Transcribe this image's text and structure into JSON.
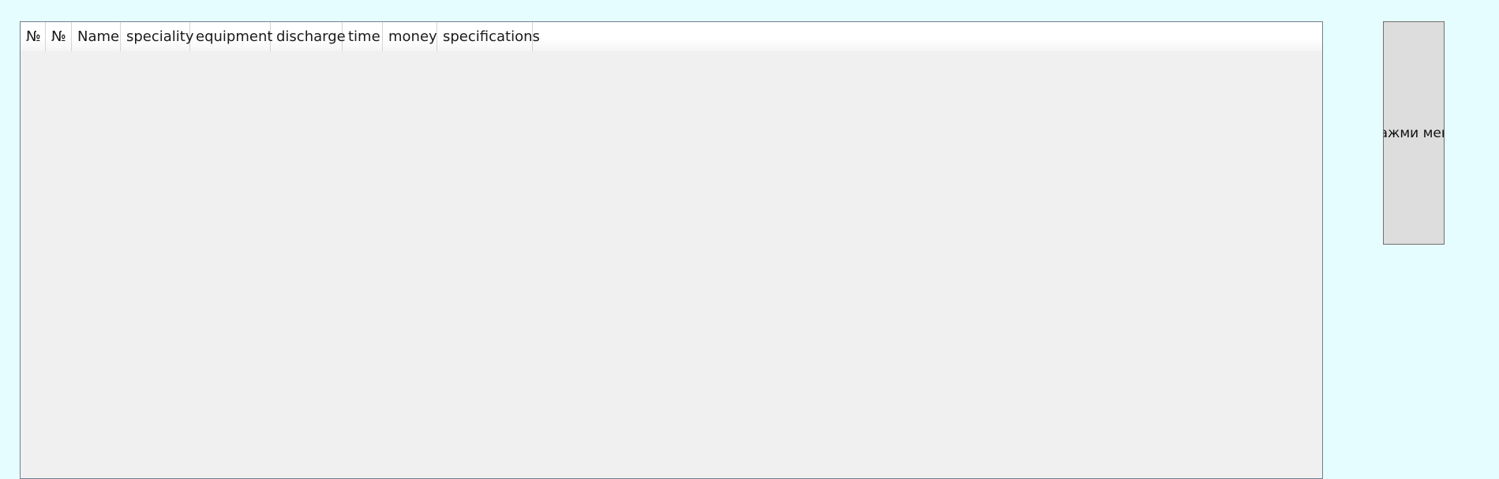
{
  "grid": {
    "columns": [
      {
        "label": "№"
      },
      {
        "label": "№"
      },
      {
        "label": "Name"
      },
      {
        "label": "speciality"
      },
      {
        "label": "equipment"
      },
      {
        "label": "discharge"
      },
      {
        "label": "time"
      },
      {
        "label": "money"
      },
      {
        "label": "specifications"
      }
    ],
    "rows": []
  },
  "button": {
    "label": "Нажми меня"
  },
  "colors": {
    "window_background": "#e6fdff",
    "grid_background": "#f0f0f0",
    "grid_border": "#6e7f90",
    "button_background": "#dddddd"
  }
}
